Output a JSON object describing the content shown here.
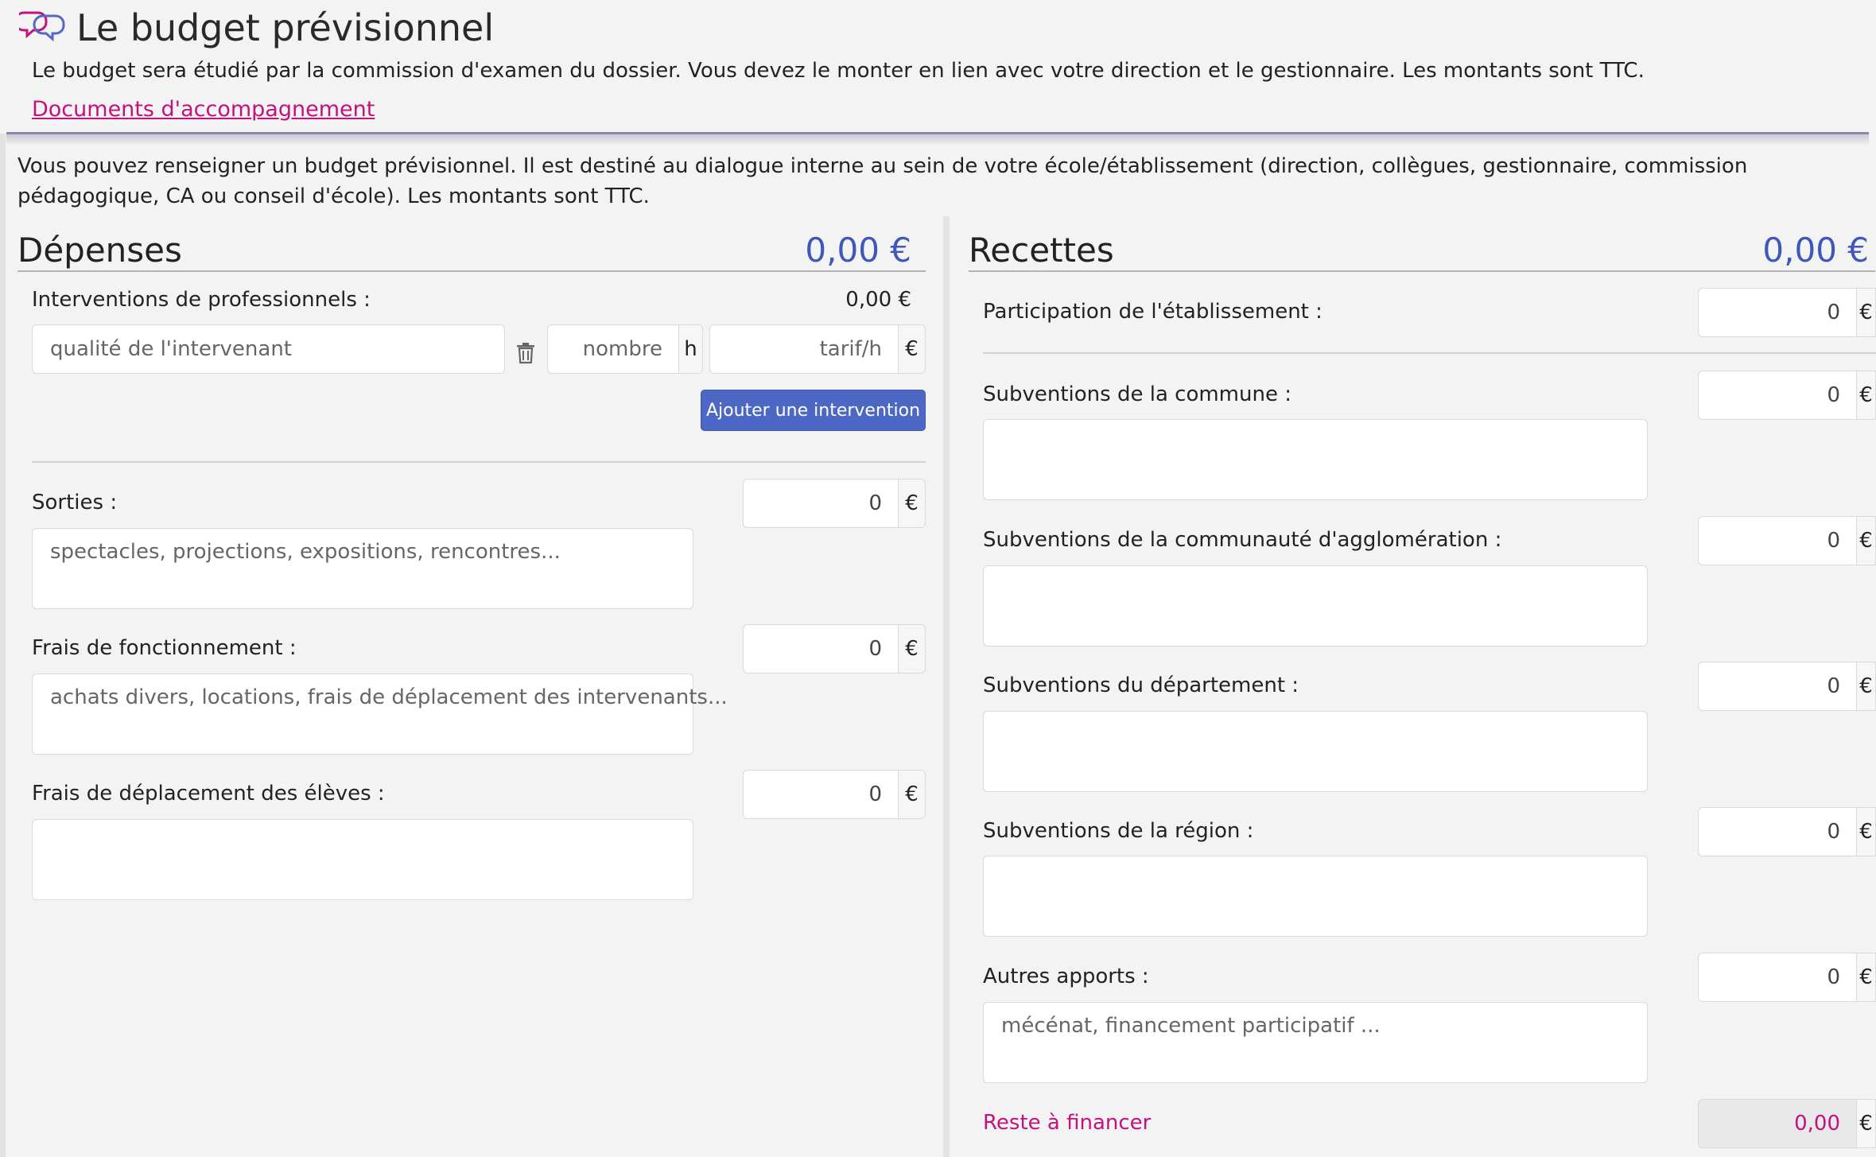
{
  "header": {
    "title": "Le budget prévisionnel",
    "intro": "Le budget sera étudié par la commission d'examen du dossier. Vous devez le monter en lien avec votre direction et le gestionnaire. Les montants sont TTC.",
    "docs_link": "Documents d'accompagnement",
    "logo_icon": "overlapping-speech-bubbles-icon",
    "accent_pink": "#c3127e",
    "accent_blue": "#3f57b8"
  },
  "description": "Vous pouvez renseigner un budget prévisionnel. Il est destiné au dialogue interne au sein de votre école/établissement (direction, collègues, gestionnaire, commission pédagogique, CA ou conseil d'école). Les montants sont TTC.",
  "depenses": {
    "title": "Dépenses",
    "total": "0,00 €",
    "interventions": {
      "label": "Interventions de professionnels :",
      "total": "0,00 €",
      "quality_placeholder": "qualité de l'intervenant",
      "delete_icon": "trash-icon",
      "nombre_placeholder": "nombre",
      "hour_unit": "h",
      "tarif_placeholder": "tarif/h",
      "currency": "€",
      "add_button": "Ajouter une intervention"
    },
    "sorties": {
      "label": "Sorties :",
      "value": "0",
      "currency": "€",
      "placeholder": "spectacles, projections, expositions, rencontres..."
    },
    "fonctionnement": {
      "label": "Frais de fonctionnement :",
      "value": "0",
      "currency": "€",
      "placeholder": "achats divers, locations, frais de déplacement des intervenants..."
    },
    "deplacement": {
      "label": "Frais de déplacement des élèves :",
      "value": "0",
      "currency": "€",
      "placeholder": ""
    }
  },
  "recettes": {
    "title": "Recettes",
    "total": "0,00 €",
    "etablissement": {
      "label": "Participation de l'établissement :",
      "value": "0",
      "currency": "€"
    },
    "commune": {
      "label": "Subventions de la commune :",
      "value": "0",
      "currency": "€"
    },
    "agglomeration": {
      "label": "Subventions de la communauté d'agglomération :",
      "value": "0",
      "currency": "€"
    },
    "departement": {
      "label": "Subventions du département :",
      "value": "0",
      "currency": "€"
    },
    "region": {
      "label": "Subventions de la région :",
      "value": "0",
      "currency": "€"
    },
    "autres": {
      "label": "Autres apports :",
      "value": "0",
      "currency": "€",
      "placeholder": "mécénat, financement participatif ..."
    },
    "reste": {
      "label": "Reste à financer",
      "value": "0,00",
      "currency": "€"
    }
  }
}
